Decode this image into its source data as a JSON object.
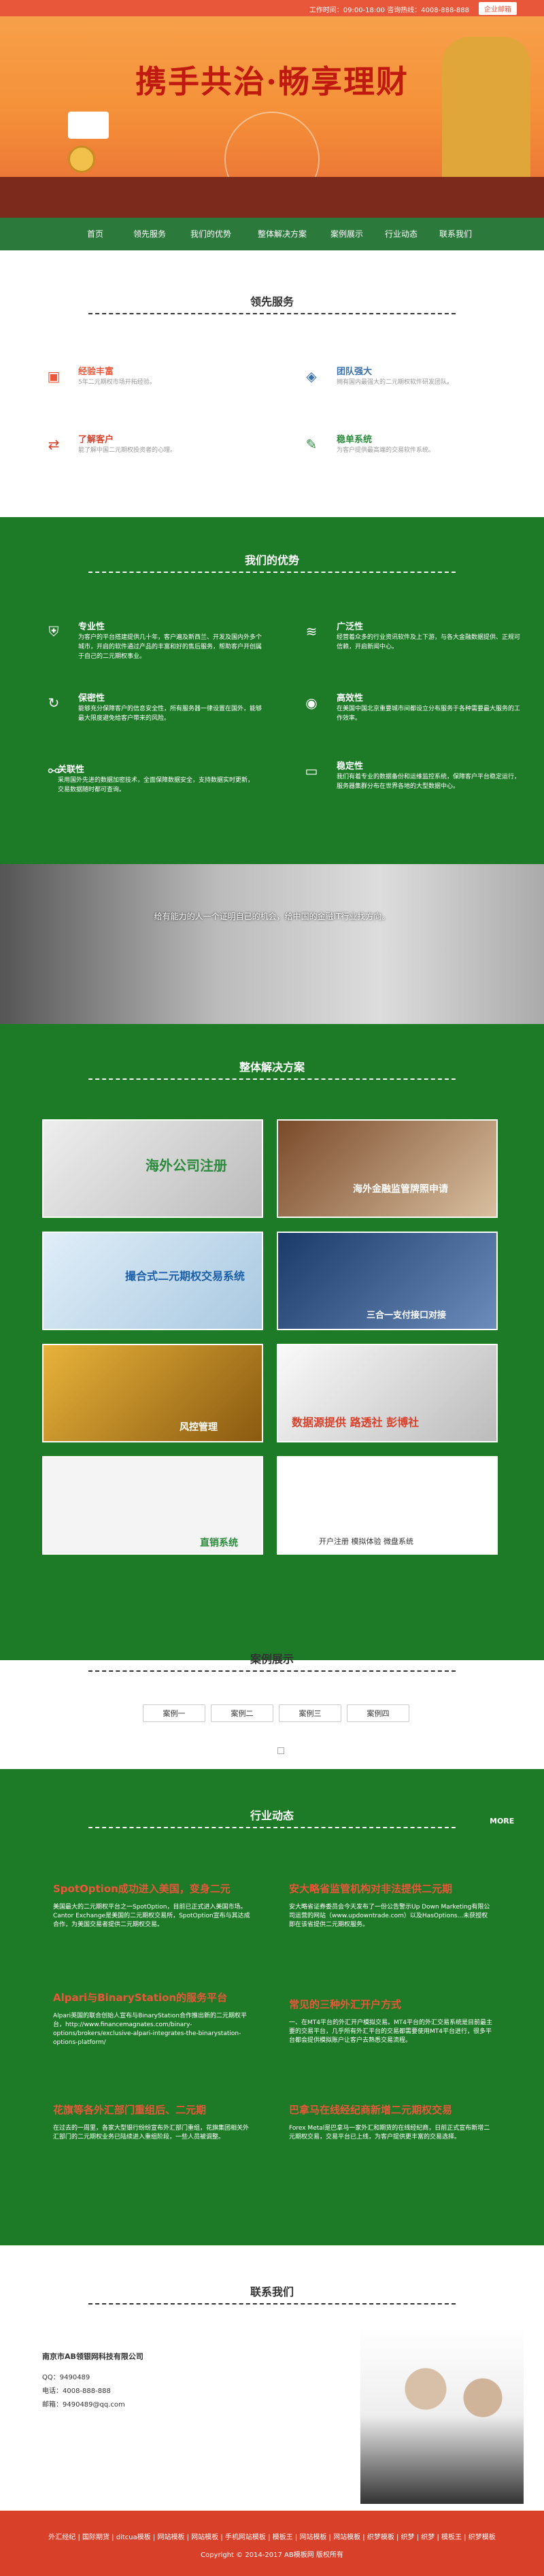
{
  "topbar": {
    "info": "工作时间：09:00-18:00   咨询热线：4008-888-888",
    "login": "企业邮箱"
  },
  "banner": {
    "title": "携手共治·畅享理财"
  },
  "nav": [
    "首页",
    "领先服务",
    "我们的优势",
    "整体解决方案",
    "案例展示",
    "行业动态",
    "联系我们"
  ],
  "services": {
    "title": "领先服务",
    "items": [
      {
        "title": "经验丰富",
        "text": "5年二元期权市场开拓经验。",
        "icon": "box-icon"
      },
      {
        "title": "团队强大",
        "text": "拥有国内最强大的二元期权软件研发团队。",
        "icon": "tag-icon"
      },
      {
        "title": "了解客户",
        "text": "能了解中国二元期权投资者的心理。",
        "icon": "shuffle-icon"
      },
      {
        "title": "稳单系统",
        "text": "为客户提供最高端的交易软件系统。",
        "icon": "edit-icon"
      }
    ]
  },
  "advantages": {
    "title": "我们的优势",
    "items": [
      {
        "title": "专业性",
        "text": "为客户的平台搭建提供几十年，客户遍及新西兰、开发及国内外多个城市，开启的软件通过产品的丰富和好的售后服务，帮助客户开创属于自己的二元期权事业。"
      },
      {
        "title": "广泛性",
        "text": "经营着众多的行业资讯软件及上下游，与各大金融数据提供、正规可信赖，开启新闻中心。"
      },
      {
        "title": "保密性",
        "text": "能够充分保障客户的信息安全性，所有服务器一律设置在国外，能够最大限度避免给客户带来的风险。"
      },
      {
        "title": "高效性",
        "text": "在美国中国北京重要城市间都设立分布服务于各种需要最大服务的工作效率。"
      },
      {
        "title": "关联性",
        "text": "采用国外先进的数据加密技术，全面保障数据安全，支持数据实时更新，交易数据随时都可查询。"
      },
      {
        "title": "稳定性",
        "text": "我们有着专业的数据备份和运维监控系统，保障客户平台稳定运行，服务器集群分布在世界各地的大型数据中心。"
      }
    ]
  },
  "slogan": "给有能力的人一个证明自己的机会，给中国的金融IT行业找方向。",
  "solutions": {
    "title": "整体解决方案",
    "items": [
      {
        "label": "海外公司注册"
      },
      {
        "label": "海外金融监管牌照申请"
      },
      {
        "label": "撮合式二元期权交易系统"
      },
      {
        "label": "三合一支付接口对接"
      },
      {
        "label": "风控管理"
      },
      {
        "label": "数据源提供 路透社 彭博社"
      },
      {
        "label": "直销系统"
      },
      {
        "label": "开户注册 模拟体验 微盘系统"
      }
    ]
  },
  "cases": {
    "title": "案例展示",
    "tabs": [
      "案例一",
      "案例二",
      "案例三",
      "案例四"
    ]
  },
  "news": {
    "title": "行业动态",
    "more": "MORE",
    "items": [
      {
        "title": "SpotOption成功进入美国，变身二元",
        "text": "美国最大的二元期权平台之一SpotOption，目前已正式进入美国市场。Cantor Exchange是美国的二元期权交易所，SpotOption宣布与其达成合作，为美国交易者提供二元期权交易。"
      },
      {
        "title": "安大略省监管机构对非法提供二元期",
        "text": "安大略省证券委员会今天发布了一份公告警示Up Down Marketing有限公司运营的网站（www.updowntrade.com）以及HasOptions...未获授权即在该省提供二元期权服务。"
      },
      {
        "title": "Alpari与BinaryStation的服务平台",
        "text": "Alpari英国的联合创始人宣布与BinaryStation合作推出新的二元期权平台，http://www.financemagnates.com/binary-options/brokers/exclusive-alpari-integrates-the-binarystation-options-platform/"
      },
      {
        "title": "常见的三种外汇开户方式",
        "text": "一、在MT4平台的外汇开户模拟交易。MT4平台的外汇交易系统是目前最主要的交易平台，几乎所有外汇平台的交易都需要使用MT4平台进行，很多平台都会提供模拟账户让客户去熟悉交易流程。"
      },
      {
        "title": "花旗等各外汇部门重组后、二元期",
        "text": "在过去的一周里，各家大型银行纷纷宣布外汇部门重组，花旗集团相关外汇部门的二元期权业务已陆续进入重组阶段，一些人员被调整。"
      },
      {
        "title": "巴拿马在线经纪商新增二元期权交易",
        "text": "Forex Metal是巴拿马一家外汇和期货的在线经纪商，日前正式宣布新增二元期权交易，交易平台已上线，为客户提供更丰富的交易选择。"
      }
    ]
  },
  "contact": {
    "title": "联系我们",
    "company": "南京市AB领银网科技有限公司",
    "qq": "QQ：9490489",
    "phone": "电话：4008-888-888",
    "email": "邮箱：9490489@qq.com"
  },
  "footer": {
    "links": "外汇经纪 | 国际期货 | ditcua模板 | 网站模板 | 网站模板 | 手机网站模板 | 模板王 | 网站模板 | 网站模板 | 织梦模板 | 织梦 | 织梦 | 模板王 | 织梦模板",
    "copyright": "Copyright © 2014-2017 AB模板网 版权所有"
  }
}
